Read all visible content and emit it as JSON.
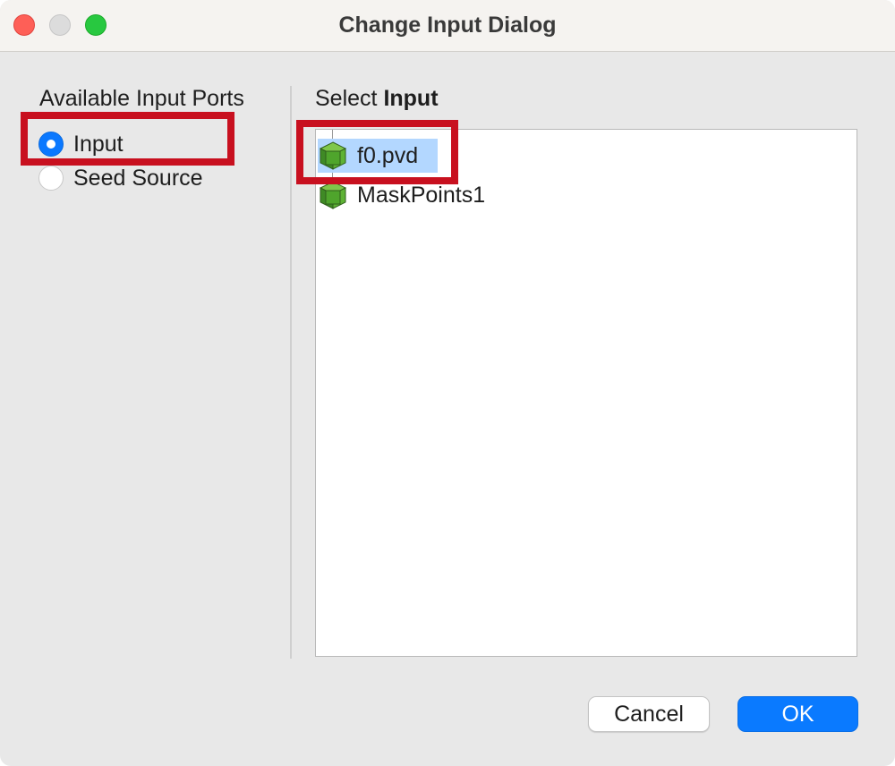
{
  "window": {
    "title": "Change Input Dialog"
  },
  "ports": {
    "heading": "Available Input Ports",
    "options": [
      {
        "label": "Input",
        "selected": true
      },
      {
        "label": "Seed Source",
        "selected": false
      }
    ]
  },
  "selection": {
    "heading_prefix": "Select ",
    "heading_emphasis": "Input",
    "items": [
      {
        "label": "f0.pvd",
        "icon": "green-cube-icon",
        "selected": true
      },
      {
        "label": "MaskPoints1",
        "icon": "green-cube-icon",
        "selected": false
      }
    ]
  },
  "buttons": {
    "cancel": "Cancel",
    "ok": "OK"
  },
  "colors": {
    "accent": "#0a7aff",
    "selection_highlight": "#b3d7ff",
    "annotation_box": "#c8101f"
  }
}
